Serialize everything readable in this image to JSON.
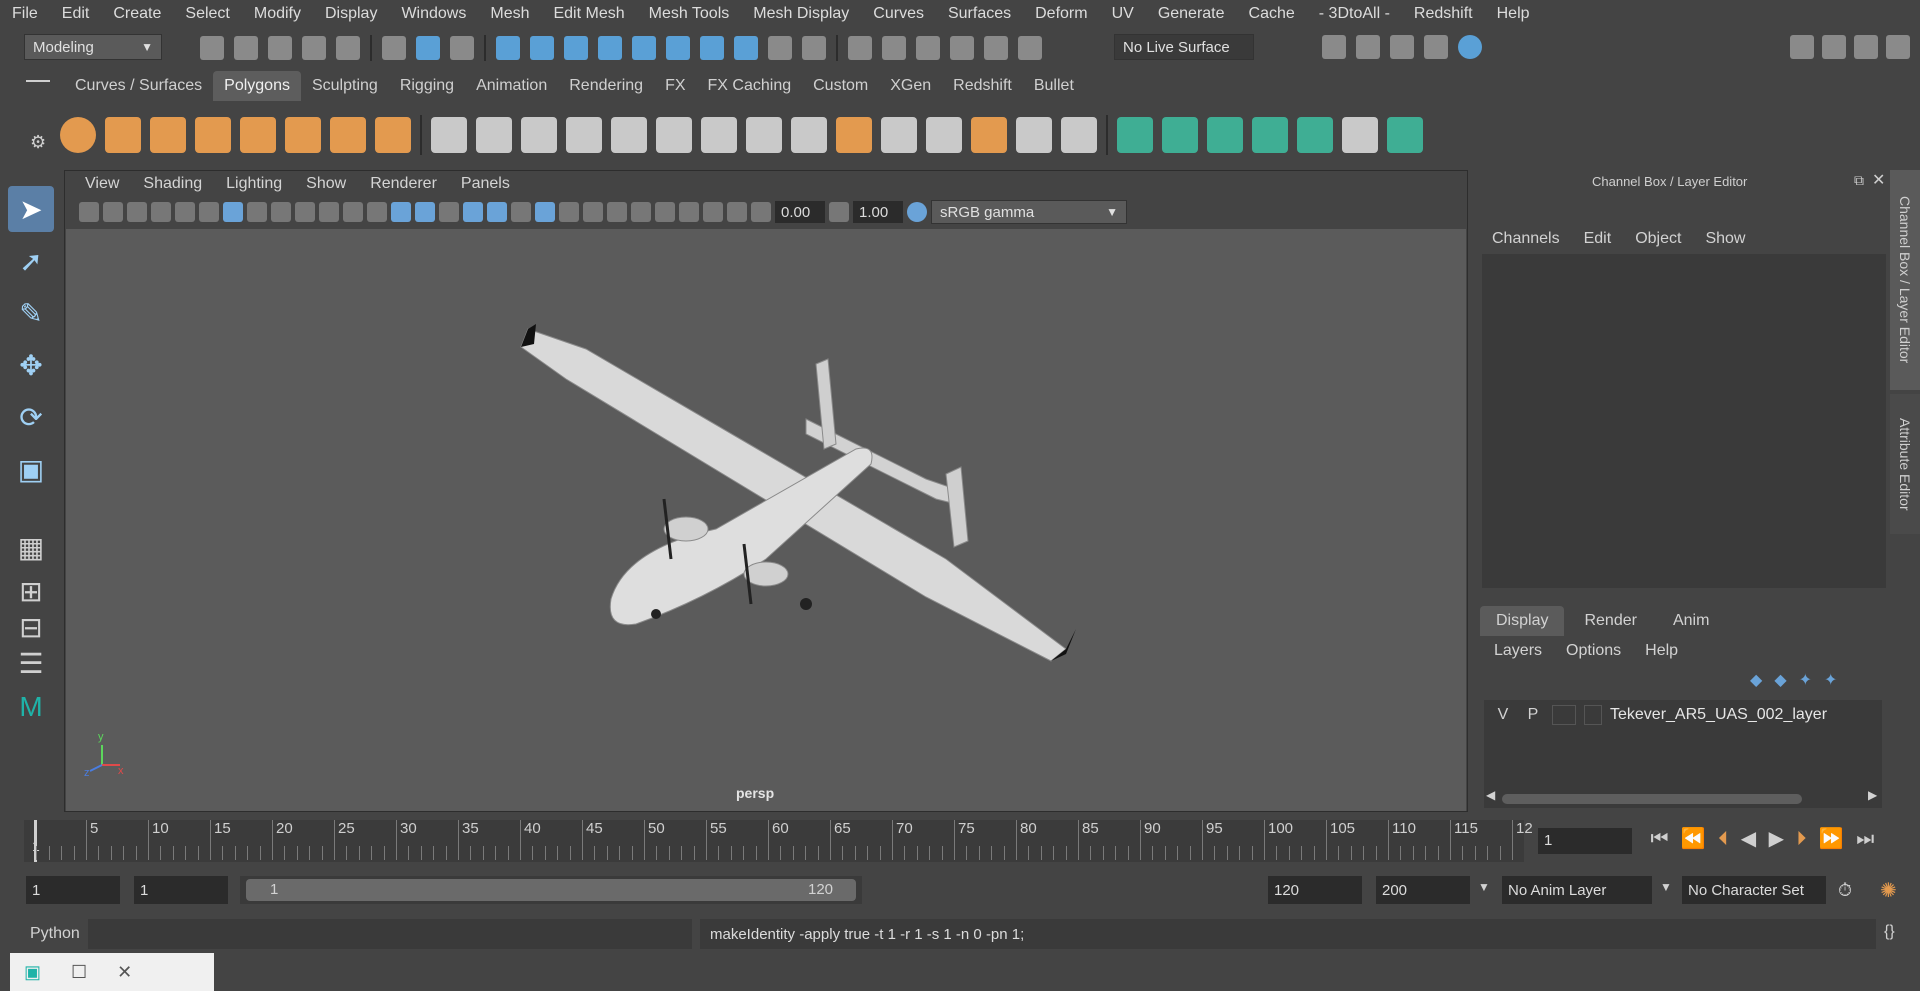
{
  "menu": [
    "File",
    "Edit",
    "Create",
    "Select",
    "Modify",
    "Display",
    "Windows",
    "Mesh",
    "Edit Mesh",
    "Mesh Tools",
    "Mesh Display",
    "Curves",
    "Surfaces",
    "Deform",
    "UV",
    "Generate",
    "Cache",
    "- 3DtoAll -",
    "Redshift",
    "Help"
  ],
  "status_line": {
    "mode": "Modeling",
    "live_surface": "No Live Surface"
  },
  "shelf_tabs": [
    "Curves / Surfaces",
    "Polygons",
    "Sculpting",
    "Rigging",
    "Animation",
    "Rendering",
    "FX",
    "FX Caching",
    "Custom",
    "XGen",
    "Redshift",
    "Bullet"
  ],
  "active_shelf_tab": "Polygons",
  "viewport": {
    "menu": [
      "View",
      "Shading",
      "Lighting",
      "Show",
      "Renderer",
      "Panels"
    ],
    "exposure": "0.00",
    "gamma": "1.00",
    "color_space": "sRGB gamma",
    "camera_label": "persp",
    "axis_x": "x",
    "axis_y": "y",
    "axis_z": "z"
  },
  "channel_box": {
    "title": "Channel Box / Layer Editor",
    "menu": [
      "Channels",
      "Edit",
      "Object",
      "Show"
    ]
  },
  "layer_editor": {
    "tabs": [
      "Display",
      "Render",
      "Anim"
    ],
    "menu": [
      "Layers",
      "Options",
      "Help"
    ],
    "layer": {
      "v": "V",
      "p": "P",
      "name": "Tekever_AR5_UAS_002_layer"
    }
  },
  "side_tabs": [
    "Channel Box / Layer Editor",
    "Attribute Editor"
  ],
  "timeline": {
    "ticks": [
      "5",
      "10",
      "15",
      "20",
      "25",
      "30",
      "35",
      "40",
      "45",
      "50",
      "55",
      "60",
      "65",
      "70",
      "75",
      "80",
      "85",
      "90",
      "95",
      "100",
      "105",
      "110",
      "115",
      "12"
    ],
    "start": "1",
    "current_frame": "1"
  },
  "range": {
    "start": "1",
    "playback_start": "1",
    "slider_start": "1",
    "slider_end": "120",
    "playback_end": "120",
    "end": "200",
    "anim_layer": "No Anim Layer",
    "character_set": "No Character Set"
  },
  "command": {
    "lang": "Python",
    "output": "makeIdentity -apply true -t 1 -r 1 -s 1 -n 0 -pn 1;"
  }
}
